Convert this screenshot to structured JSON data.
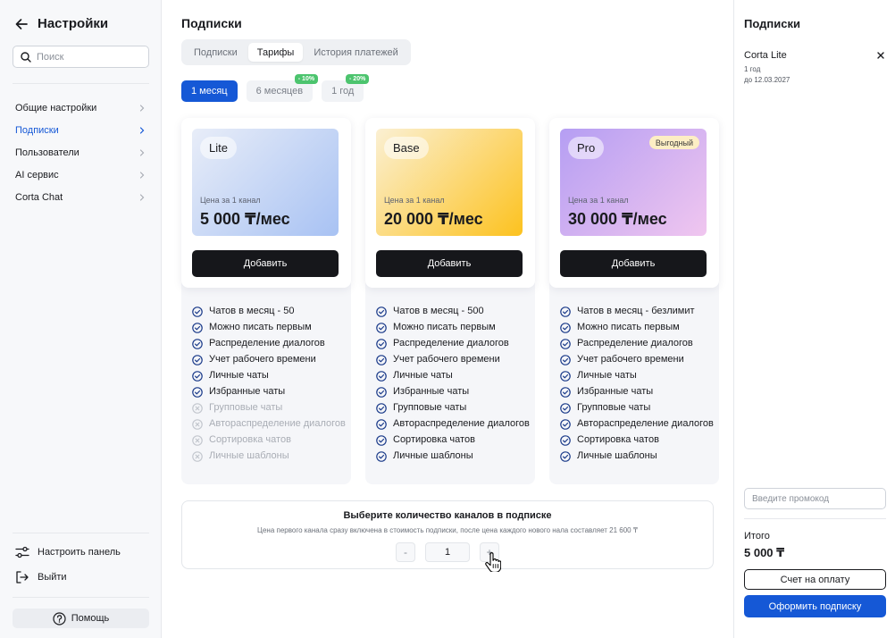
{
  "sidebar": {
    "title": "Настройки",
    "search_placeholder": "Поиск",
    "items": [
      {
        "label": "Общие настройки"
      },
      {
        "label": "Подписки"
      },
      {
        "label": "Пользователи"
      },
      {
        "label": "AI сервис"
      },
      {
        "label": "Corta Chat"
      }
    ],
    "customize_label": "Настроить панель",
    "logout_label": "Выйти",
    "help_label": "Помощь"
  },
  "main": {
    "title": "Подписки",
    "tabs": [
      {
        "label": "Подписки"
      },
      {
        "label": "Тарифы"
      },
      {
        "label": "История платежей"
      }
    ],
    "periods": [
      {
        "label": "1 месяц",
        "discount": ""
      },
      {
        "label": "6 месяцев",
        "discount": "- 10%"
      },
      {
        "label": "1 год",
        "discount": "- 20%"
      }
    ],
    "plans": [
      {
        "name": "Lite",
        "badge": "",
        "price_caption": "Цена за 1 канал",
        "price": "5 000 ₸/мес",
        "button": "Добавить",
        "features": [
          {
            "text": "Чатов в месяц - 50",
            "enabled": true
          },
          {
            "text": "Можно писать первым",
            "enabled": true
          },
          {
            "text": "Распределение диалогов",
            "enabled": true
          },
          {
            "text": "Учет рабочего времени",
            "enabled": true
          },
          {
            "text": "Личные чаты",
            "enabled": true
          },
          {
            "text": "Избранные чаты",
            "enabled": true
          },
          {
            "text": "Групповые чаты",
            "enabled": false
          },
          {
            "text": "Автораспределение диалогов",
            "enabled": false
          },
          {
            "text": "Сортировка чатов",
            "enabled": false
          },
          {
            "text": "Личные шаблоны",
            "enabled": false
          }
        ]
      },
      {
        "name": "Base",
        "badge": "",
        "price_caption": "Цена за 1 канал",
        "price": "20 000 ₸/мес",
        "button": "Добавить",
        "features": [
          {
            "text": "Чатов в месяц - 500",
            "enabled": true
          },
          {
            "text": "Можно писать первым",
            "enabled": true
          },
          {
            "text": "Распределение диалогов",
            "enabled": true
          },
          {
            "text": "Учет рабочего времени",
            "enabled": true
          },
          {
            "text": "Личные чаты",
            "enabled": true
          },
          {
            "text": "Избранные чаты",
            "enabled": true
          },
          {
            "text": "Групповые чаты",
            "enabled": true
          },
          {
            "text": "Автораспределение диалогов",
            "enabled": true
          },
          {
            "text": "Сортировка чатов",
            "enabled": true
          },
          {
            "text": "Личные шаблоны",
            "enabled": true
          }
        ]
      },
      {
        "name": "Pro",
        "badge": "Выгодный",
        "price_caption": "Цена за 1 канал",
        "price": "30 000 ₸/мес",
        "button": "Добавить",
        "features": [
          {
            "text": "Чатов в месяц - безлимит",
            "enabled": true
          },
          {
            "text": "Можно писать первым",
            "enabled": true
          },
          {
            "text": "Распределение диалогов",
            "enabled": true
          },
          {
            "text": "Учет рабочего времени",
            "enabled": true
          },
          {
            "text": "Личные чаты",
            "enabled": true
          },
          {
            "text": "Избранные чаты",
            "enabled": true
          },
          {
            "text": "Групповые чаты",
            "enabled": true
          },
          {
            "text": "Автораспределение диалогов",
            "enabled": true
          },
          {
            "text": "Сортировка чатов",
            "enabled": true
          },
          {
            "text": "Личные шаблоны",
            "enabled": true
          }
        ]
      }
    ],
    "channels": {
      "title": "Выберите количество каналов в подписке",
      "subtitle": "Цена первого канала сразу включена в стоимость подписки, после цена каждого нового нала составляет 21 600 ₸",
      "minus": "-",
      "value": "1",
      "plus": "+"
    }
  },
  "summary": {
    "title": "Подписки",
    "item_name": "Corta Lite",
    "item_period": "1 год",
    "item_until": "до 12.03.2027",
    "promo_placeholder": "Введите промокод",
    "total_label": "Итого",
    "total_value": "5 000 ₸",
    "invoice_button": "Счет на оплату",
    "subscribe_button": "Оформить подписку"
  },
  "colors": {
    "accent": "#1558d6",
    "dark_button": "#16171b",
    "discount_badge": "#4cc46e",
    "check_icon": "#1b3b8a",
    "disabled_icon": "#c3c7ce"
  },
  "icons": {
    "back": "arrow-left-icon",
    "search": "search-icon",
    "chevron": "chevron-right-icon",
    "customize": "sliders-icon",
    "logout": "logout-icon",
    "help": "help-circle-icon",
    "close": "close-icon",
    "feature_on": "check-circle-icon",
    "feature_off": "x-circle-icon"
  },
  "state": {
    "active_nav": 1,
    "active_tab": 1,
    "active_period": 0
  }
}
